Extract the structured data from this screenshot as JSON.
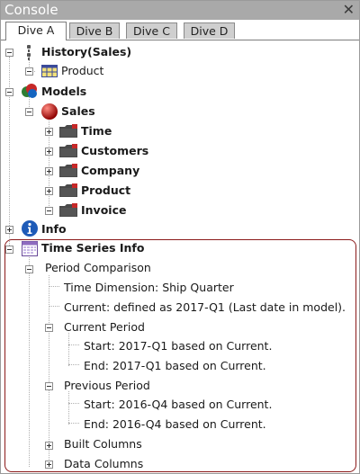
{
  "window": {
    "title": "Console"
  },
  "tabs": [
    {
      "label": "Dive A",
      "active": true
    },
    {
      "label": "Dive B",
      "active": false
    },
    {
      "label": "Dive C",
      "active": false
    },
    {
      "label": "Dive D",
      "active": false
    }
  ],
  "tree": {
    "history": {
      "label": "History(Sales)",
      "icon": "history-icon",
      "expanded": true
    },
    "history_product": {
      "label": "Product",
      "icon": "table-icon"
    },
    "models": {
      "label": "Models",
      "icon": "models-icon",
      "expanded": true
    },
    "sales": {
      "label": "Sales",
      "icon": "sphere-icon",
      "expanded": true
    },
    "time": {
      "label": "Time",
      "icon": "dimension-icon",
      "expanded": false
    },
    "customers": {
      "label": "Customers",
      "icon": "dimension-icon",
      "expanded": false
    },
    "company": {
      "label": "Company",
      "icon": "dimension-icon",
      "expanded": false
    },
    "product": {
      "label": "Product",
      "icon": "dimension-icon",
      "expanded": false
    },
    "invoice": {
      "label": "Invoice",
      "icon": "dimension-icon",
      "expanded": true
    },
    "info": {
      "label": "Info",
      "icon": "info-icon",
      "expanded": false
    },
    "time_series": {
      "label": "Time Series Info",
      "icon": "calendar-icon",
      "expanded": true
    },
    "period_comparison": {
      "label": "Period Comparison",
      "expanded": true
    },
    "time_dimension": {
      "label": "Time Dimension: Ship Quarter"
    },
    "current_def": {
      "label": "Current: defined as 2017-Q1 (Last date in model)."
    },
    "current_period": {
      "label": "Current Period",
      "expanded": true
    },
    "cp_start": {
      "label": "Start: 2017-Q1 based on Current."
    },
    "cp_end": {
      "label": "End: 2017-Q1 based on Current."
    },
    "previous_period": {
      "label": "Previous Period",
      "expanded": true
    },
    "pp_start": {
      "label": "Start: 2016-Q4 based on Current."
    },
    "pp_end": {
      "label": "End: 2016-Q4 based on Current."
    },
    "built_columns": {
      "label": "Built Columns",
      "expanded": false
    },
    "data_columns": {
      "label": "Data Columns",
      "expanded": false
    }
  },
  "colors": {
    "titlebar": "#a9a9a9",
    "highlight_border": "#8b1a1a",
    "tab_inactive": "#cfcfcf"
  }
}
